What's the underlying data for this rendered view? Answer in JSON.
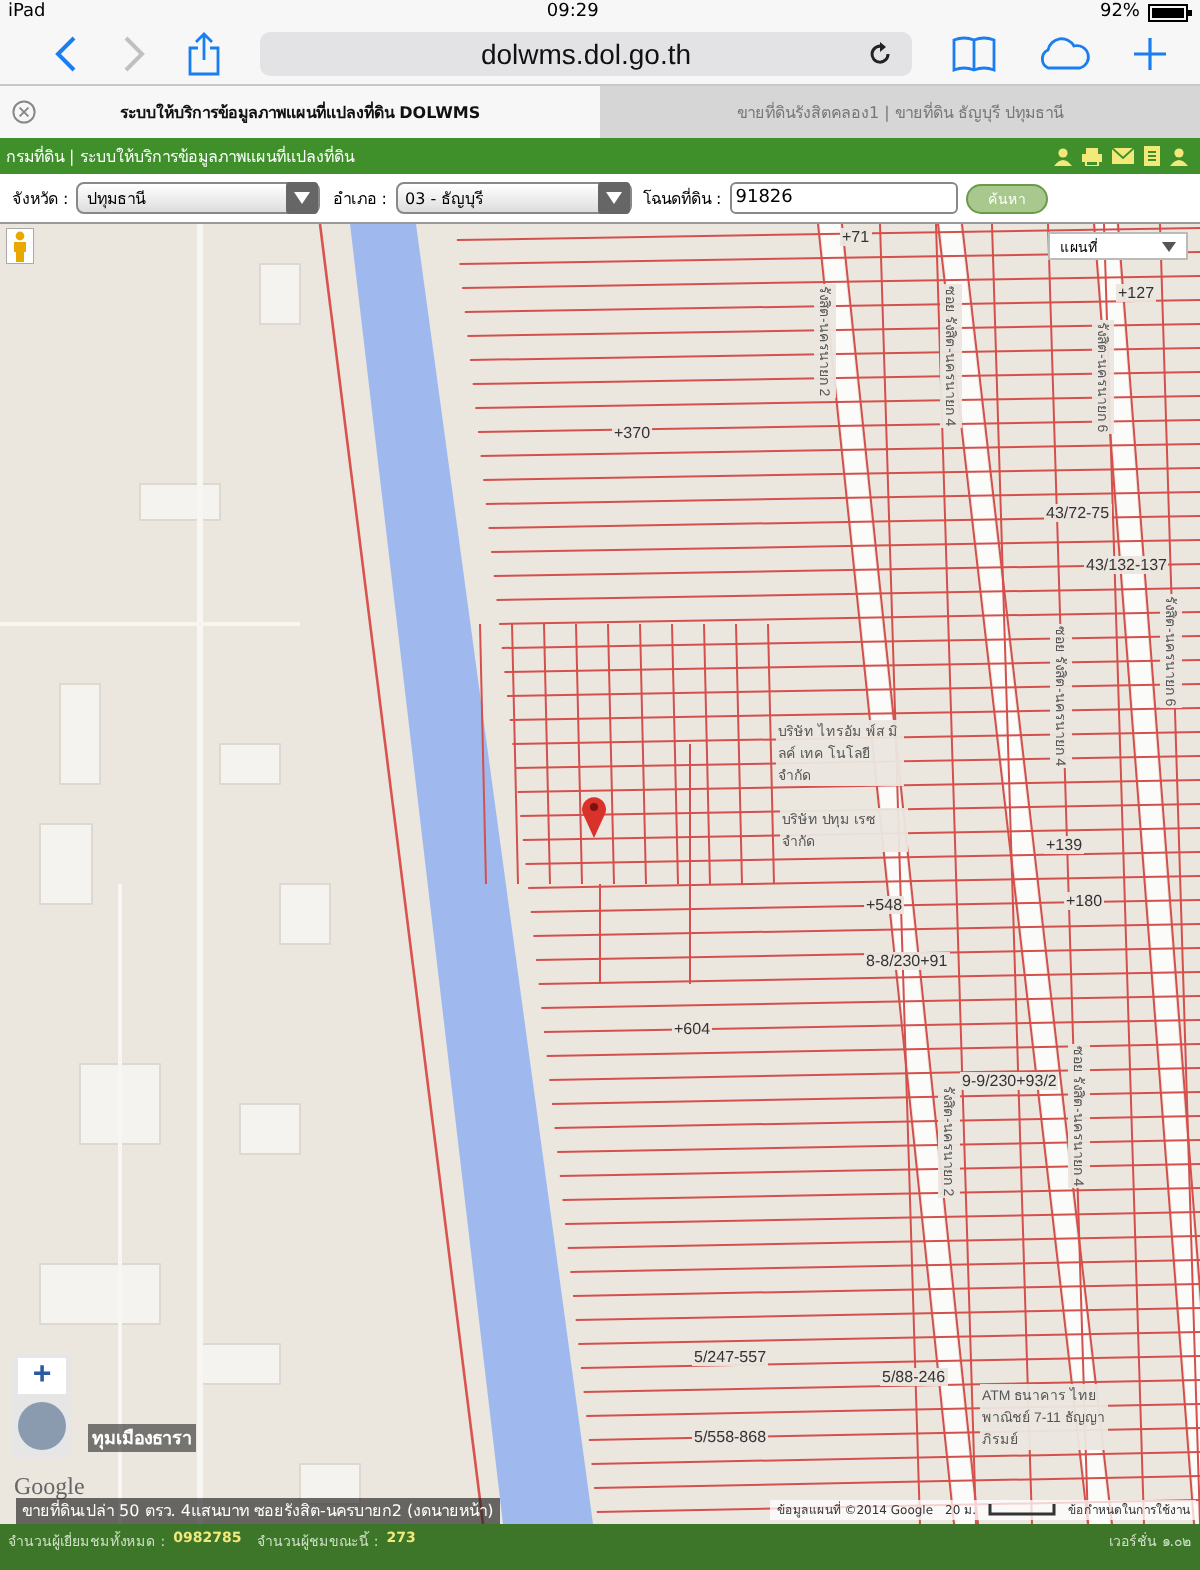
{
  "status_bar": {
    "carrier": "iPad",
    "time": "09:29",
    "battery": "92%"
  },
  "browser": {
    "url": "dolwms.dol.go.th",
    "back_enabled": true,
    "forward_enabled": false,
    "tabs": [
      {
        "title": "ระบบให้บริการข้อมูลภาพแผนที่แปลงที่ดิน DOLWMS",
        "selected": true
      },
      {
        "title": "ขายที่ดินรังสิตคลอง1 | ขายที่ดิน ธัญบุรี ปทุมธานี",
        "selected": false
      }
    ]
  },
  "site_header": {
    "title": "กรมที่ดิน | ระบบให้บริการข้อมูลภาพแผนที่แปลงที่ดิน"
  },
  "search_form": {
    "province_label": "จังหวัด :",
    "province": "ปทุมธานี",
    "district_label": "อำเภอ :",
    "district": "03 - ธัญบุรี",
    "deed_label": "โฉนดที่ดิน :",
    "deed_number": "91826",
    "search_button": "ค้นหา"
  },
  "map": {
    "type_selector": "แผนที่",
    "zoom_in": "+",
    "labels": [
      {
        "text": "+71",
        "kind": "parcel"
      },
      {
        "text": "+127",
        "kind": "parcel"
      },
      {
        "text": "+370",
        "kind": "parcel"
      },
      {
        "text": "43/72-75",
        "kind": "parcel"
      },
      {
        "text": "43/132-137",
        "kind": "parcel"
      },
      {
        "text": "+139",
        "kind": "parcel"
      },
      {
        "text": "+180",
        "kind": "parcel"
      },
      {
        "text": "+548",
        "kind": "parcel"
      },
      {
        "text": "8-8/230+91",
        "kind": "parcel"
      },
      {
        "text": "+604",
        "kind": "parcel"
      },
      {
        "text": "9-9/230+93/2",
        "kind": "parcel"
      },
      {
        "text": "5/247-557",
        "kind": "parcel"
      },
      {
        "text": "5/88-246",
        "kind": "parcel"
      },
      {
        "text": "5/558-868",
        "kind": "parcel"
      },
      {
        "text": "รังสิต-นครนายก 2",
        "kind": "road"
      },
      {
        "text": "ซอย รังสิต-นครนายก 4",
        "kind": "road"
      },
      {
        "text": "รังสิต-นครนายก 6",
        "kind": "road"
      },
      {
        "text": "ซอย รังสิต-นครนายก 4",
        "kind": "road"
      },
      {
        "text": "รังสิต-นครนายก 6",
        "kind": "road"
      },
      {
        "text": "รังสิต-นครนายก 2",
        "kind": "road"
      },
      {
        "text": "ซอย รังสิต-นครนายก 4",
        "kind": "road"
      },
      {
        "text": "บริษัท ไทรอัม พ์ส มิลค์ เทค โนโลยี จำกัด",
        "kind": "place"
      },
      {
        "text": "บริษัท ปทุม เรซ จำกัด",
        "kind": "place"
      },
      {
        "text": "ATM ธนาคาร ไทยพาณิชย์ 7-11 ธัญญาภิรมย์",
        "kind": "place"
      }
    ],
    "street_view_label": "ทุมเมืองธารา",
    "logo": "Google",
    "listing_caption": "ขายที่ดินเปล่า 50 ตรว. 4แสนบาท ซอยรังสิต-นครบายก2 (งดนายหน้า)",
    "attribution": "ข้อมูลแผนที่ ©2014 Google",
    "scale": "20 ม.",
    "terms": "ข้อกำหนดในการใช้งาน"
  },
  "footer": {
    "visitors_total_label": "จำนวนผู้เยี่ยมชมทั้งหมด :",
    "visitors_total": "0982785",
    "visitors_now_label": "จำนวนผู้ชมขณะนี้ :",
    "visitors_now": "273",
    "version": "เวอร์ชั่น ๑.๐๒"
  }
}
